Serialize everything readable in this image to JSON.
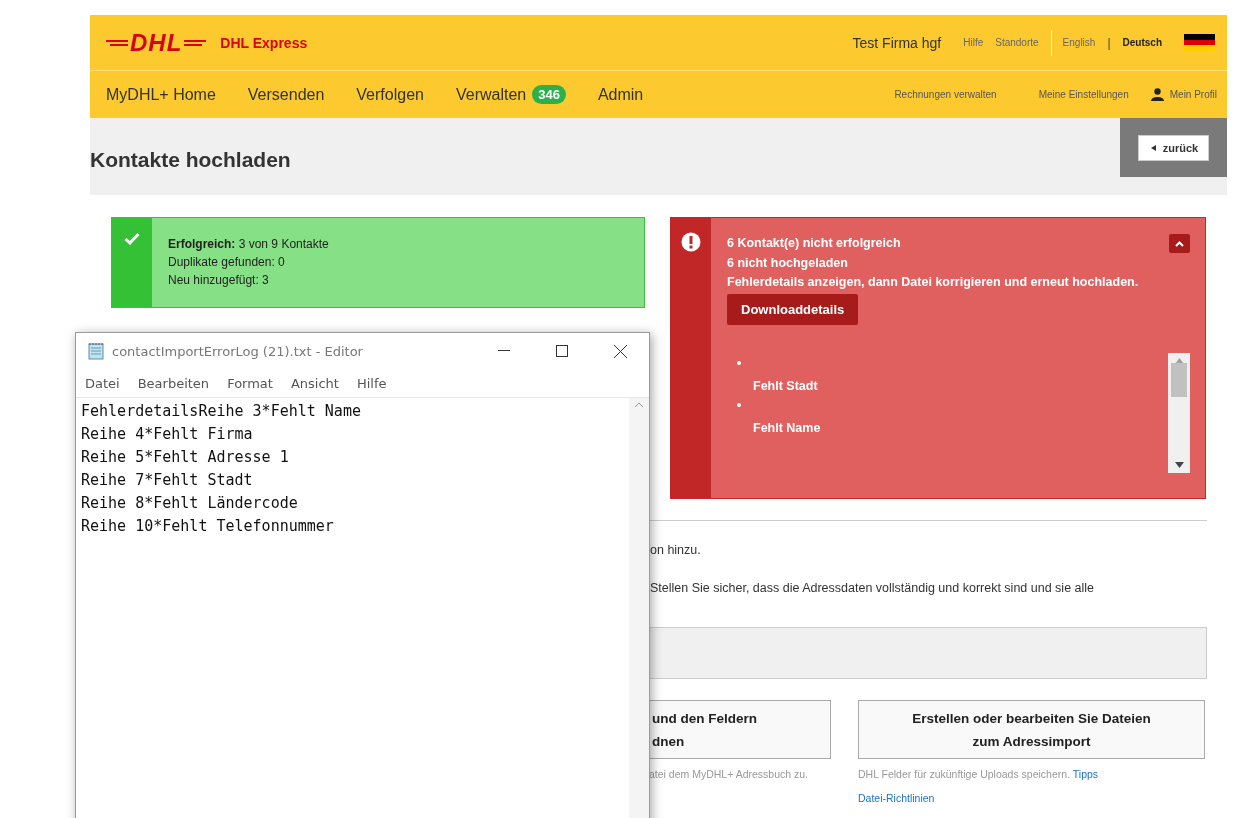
{
  "header": {
    "logo": "DHL",
    "brand": "DHL Express",
    "company": "Test Firma hgf",
    "links": [
      {
        "label": "Hilfe"
      },
      {
        "label": "Standorte"
      }
    ],
    "languages": [
      {
        "label": "English",
        "selected": false
      },
      {
        "label": "Deutsch",
        "selected": true
      }
    ],
    "separator": "|"
  },
  "nav": {
    "items": [
      {
        "label": "MyDHL+ Home"
      },
      {
        "label": "Versenden"
      },
      {
        "label": "Verfolgen"
      },
      {
        "label": "Verwalten",
        "badge": "346"
      },
      {
        "label": "Admin"
      }
    ],
    "links": [
      {
        "label": "Rechnungen verwalten"
      },
      {
        "label": "Meine Einstellungen"
      },
      {
        "label": "Mein Profil",
        "kind": "profile"
      }
    ]
  },
  "back_button": {
    "label": "zurück"
  },
  "page_title": "Kontakte hochladen",
  "success": {
    "lines": [
      "**Erfolgreich:** 3 von 9 Kontakte",
      "Duplikate gefunden: 0",
      "Neu hinzugefügt: 3"
    ]
  },
  "error": {
    "expanded": true,
    "lines": [
      "6 Kontakt(e) nicht erfolgreich",
      "6 nicht hochgeladen",
      "Fehlerdetails anzeigen, dann Datei korrigieren und erneut hochladen."
    ],
    "button": "Downloaddetails",
    "items": [
      "Fehlt Stadt",
      "Fehlt Name"
    ]
  },
  "instructions": [
    "on hinzu.",
    "Stellen Sie sicher, dass die Adressdaten vollständig und korrekt sind und sie alle"
  ],
  "actions": [
    {
      "lines": [
        "und den Feldern",
        "dnen"
      ],
      "caption": "atei dem MyDHL+ Adressbuch zu."
    },
    {
      "lines": [
        "Erstellen oder bearbeiten Sie Dateien",
        "zum Adressimport"
      ],
      "caption": "DHL Felder für zukünftige Uploads speichern.",
      "caption_link": "Tipps",
      "link": "Datei-Richtlinien"
    }
  ],
  "notepad": {
    "title": "contactImportErrorLog (21).txt - Editor",
    "menu": [
      "Datei",
      "Bearbeiten",
      "Format",
      "Ansicht",
      "Hilfe"
    ],
    "lines": [
      "FehlerdetailsReihe 3*Fehlt Name",
      "Reihe 4*Fehlt Firma",
      "Reihe 5*Fehlt Adresse 1",
      "Reihe 7*Fehlt Stadt",
      "Reihe 8*Fehlt Ländercode",
      "Reihe 10*Fehlt Telefonnummer"
    ]
  }
}
